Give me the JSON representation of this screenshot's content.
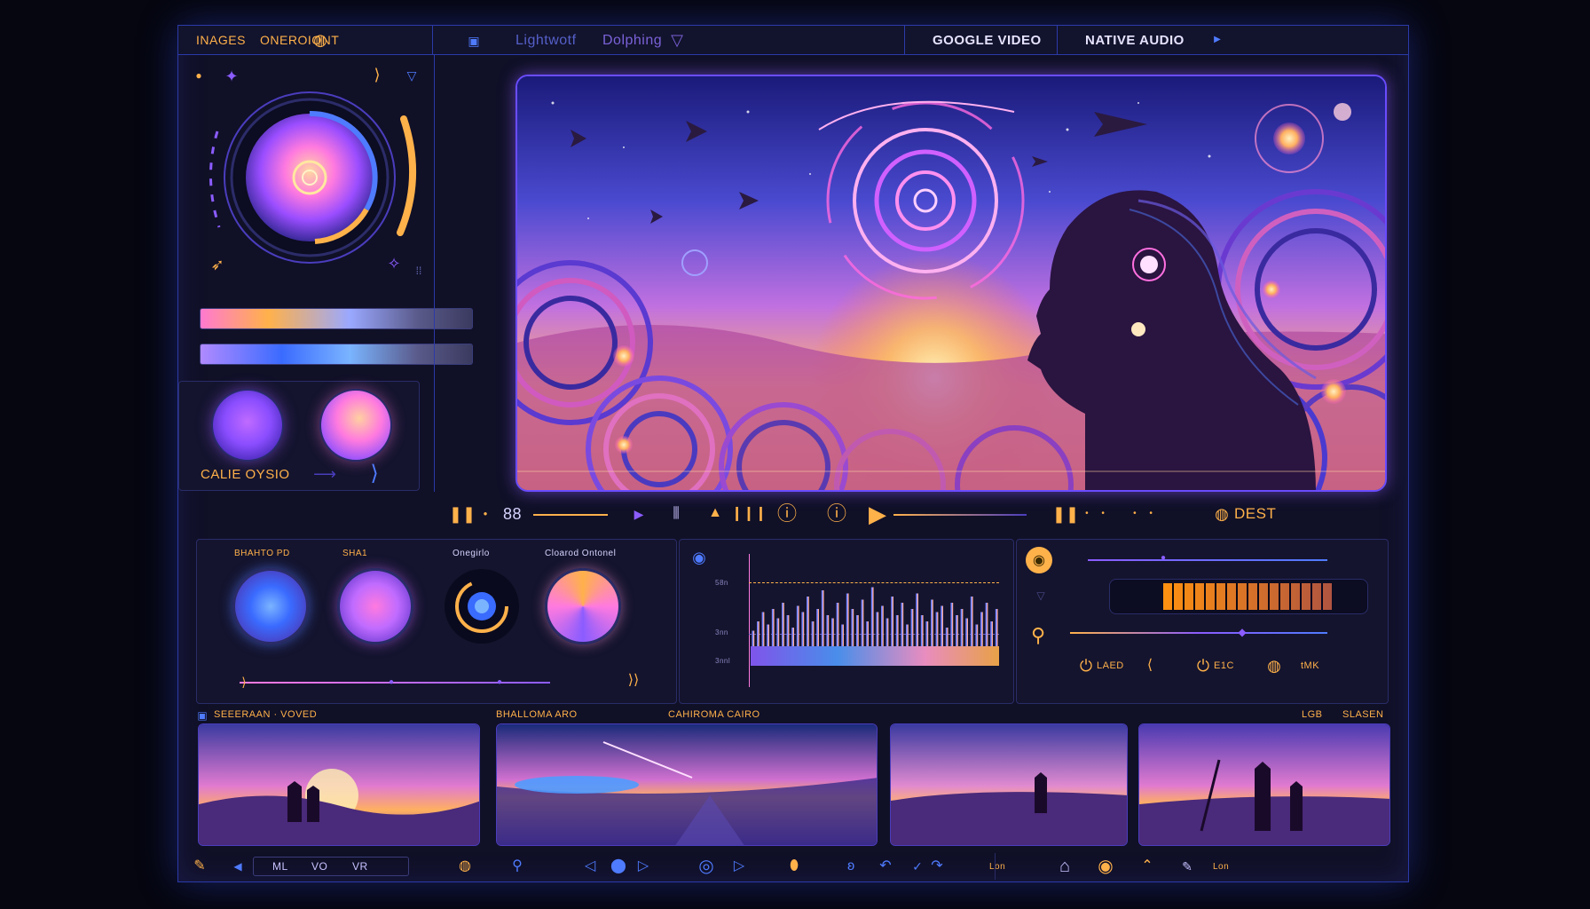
{
  "topbar": {
    "tab_images": "INAGES",
    "tab_project": "ONEROIONT",
    "search_left": "Lightwotf",
    "search_right": "Dolphing",
    "tab_video": "GOOGLE VIDEO",
    "tab_audio": "NATIVE AUDIO"
  },
  "left_panel": {
    "cable_label": "CALIE OYSIO"
  },
  "transport": {
    "counter": "88",
    "right_label": "DEST"
  },
  "mixer": {
    "labels": [
      "BHAHTO PD",
      "SHA1",
      "Onegirlo",
      "Cloarod Ontonel"
    ]
  },
  "waveform": {
    "ticks": [
      "58n",
      "3nn",
      "3nnl"
    ],
    "bar_values": [
      0.25,
      0.4,
      0.55,
      0.35,
      0.6,
      0.45,
      0.7,
      0.5,
      0.3,
      0.65,
      0.55,
      0.8,
      0.4,
      0.6,
      0.9,
      0.5,
      0.45,
      0.7,
      0.35,
      0.85,
      0.6,
      0.5,
      0.75,
      0.4,
      0.95,
      0.55,
      0.65,
      0.45,
      0.8,
      0.5,
      0.7,
      0.35,
      0.6,
      0.85,
      0.5,
      0.4,
      0.75,
      0.55,
      0.65,
      0.3,
      0.7,
      0.5,
      0.6,
      0.45,
      0.8,
      0.35,
      0.55,
      0.7,
      0.4,
      0.6
    ]
  },
  "controls_panel": {
    "labels": [
      "LAED",
      "E1C",
      "tMK"
    ]
  },
  "timeline": {
    "header_left": "SEEERAAN · VOVED",
    "header_mid_1": "BHALLOMA ARO",
    "header_mid_2": "CAHIROMA CAIRO",
    "header_right_1": "LGB",
    "header_right_2": "SLASEN",
    "left_footer": [
      "ML",
      "VO",
      "VR"
    ],
    "right_footer_label": "Lon",
    "end_footer_label": "Lon"
  },
  "colors": {
    "accent_purple": "#8b5cff",
    "accent_orange": "#ffb14a",
    "accent_blue": "#3a6bff",
    "border": "#2b3aa8"
  }
}
